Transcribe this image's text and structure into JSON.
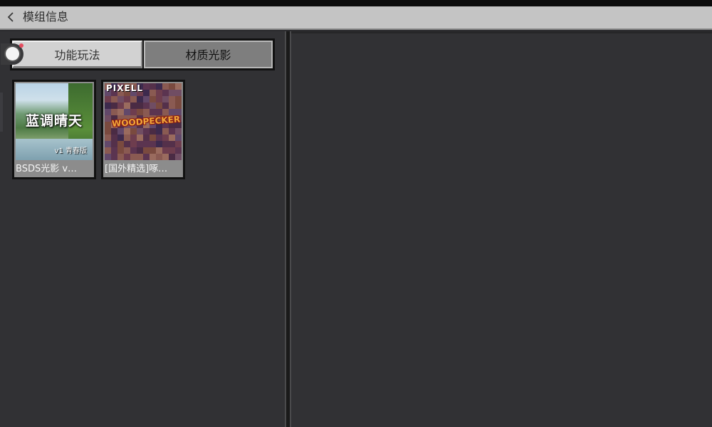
{
  "header": {
    "title": "模组信息",
    "back_icon": "chevron-left-icon"
  },
  "tabs": [
    {
      "label": "功能玩法",
      "active": false
    },
    {
      "label": "材质光影",
      "active": true
    }
  ],
  "toggle": {
    "icon": "toggle-switch-icon",
    "badge_color": "#e44d5f"
  },
  "items": [
    {
      "label": "BSDS光影 v…",
      "thumbnail_title": "蓝调晴天",
      "thumbnail_subtitle": "v1 青春版"
    },
    {
      "label": "[国外精选]啄…",
      "thumbnail_brand": "PIXELL",
      "thumbnail_title": "WOODPECKER"
    }
  ],
  "colors": {
    "header_bg": "#c4c4c4",
    "panel_bg": "#313134",
    "tab_active_bg": "#7e7e7e",
    "tab_inactive_bg": "#d2d2d2"
  }
}
